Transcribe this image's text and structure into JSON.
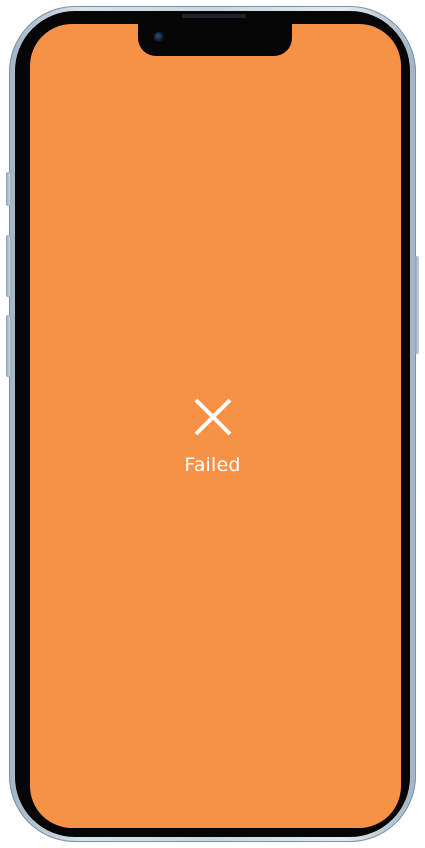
{
  "status": {
    "label": "Failed",
    "icon": "close-icon"
  },
  "colors": {
    "screen_background": "#f79145",
    "icon": "#ffffff",
    "text": "#ffffff"
  }
}
